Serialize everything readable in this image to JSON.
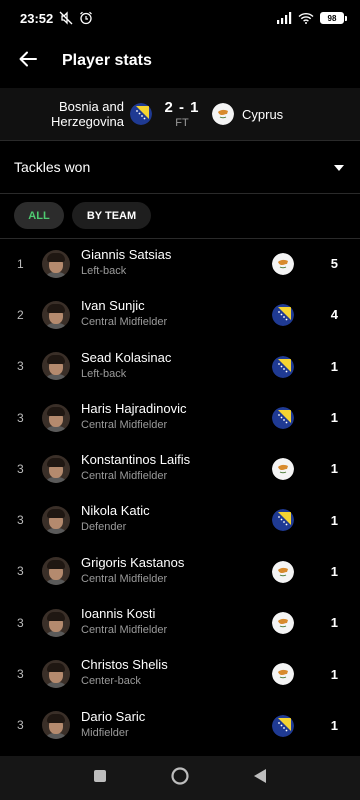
{
  "status_bar": {
    "time": "23:52",
    "battery": "98",
    "icons": [
      "mute-icon",
      "alarm-icon",
      "signal-icon",
      "wifi-icon",
      "battery-icon"
    ]
  },
  "app_bar": {
    "title": "Player stats",
    "back_icon": "arrow-left-icon"
  },
  "match": {
    "home_team_line1": "Bosnia and",
    "home_team_line2": "Herzegovina",
    "score": "2 - 1",
    "status": "FT",
    "away_team": "Cyprus"
  },
  "stat_selector": {
    "label": "Tackles won",
    "icon": "caret-down-icon"
  },
  "filters": {
    "all": "ALL",
    "by_team": "BY TEAM",
    "active": "ALL"
  },
  "colors": {
    "accent_green": "#4ecb71",
    "background": "#000000",
    "secondary_text": "#9a9a9a"
  },
  "players": [
    {
      "rank": "1",
      "name": "Giannis Satsias",
      "position": "Left-back",
      "team": "cyprus",
      "value": "5"
    },
    {
      "rank": "2",
      "name": "Ivan Sunjic",
      "position": "Central Midfielder",
      "team": "bosnia",
      "value": "4"
    },
    {
      "rank": "3",
      "name": "Sead Kolasinac",
      "position": "Left-back",
      "team": "bosnia",
      "value": "1"
    },
    {
      "rank": "3",
      "name": "Haris Hajradinovic",
      "position": "Central Midfielder",
      "team": "bosnia",
      "value": "1"
    },
    {
      "rank": "3",
      "name": "Konstantinos Laifis",
      "position": "Central Midfielder",
      "team": "cyprus",
      "value": "1"
    },
    {
      "rank": "3",
      "name": "Nikola Katic",
      "position": "Defender",
      "team": "bosnia",
      "value": "1"
    },
    {
      "rank": "3",
      "name": "Grigoris Kastanos",
      "position": "Central Midfielder",
      "team": "cyprus",
      "value": "1"
    },
    {
      "rank": "3",
      "name": "Ioannis Kosti",
      "position": "Central Midfielder",
      "team": "cyprus",
      "value": "1"
    },
    {
      "rank": "3",
      "name": "Christos Shelis",
      "position": "Center-back",
      "team": "cyprus",
      "value": "1"
    },
    {
      "rank": "3",
      "name": "Dario Saric",
      "position": "Midfielder",
      "team": "bosnia",
      "value": "1"
    }
  ],
  "nav_bar": {
    "icons": [
      "recents-square-icon",
      "home-circle-icon",
      "back-triangle-icon"
    ]
  }
}
